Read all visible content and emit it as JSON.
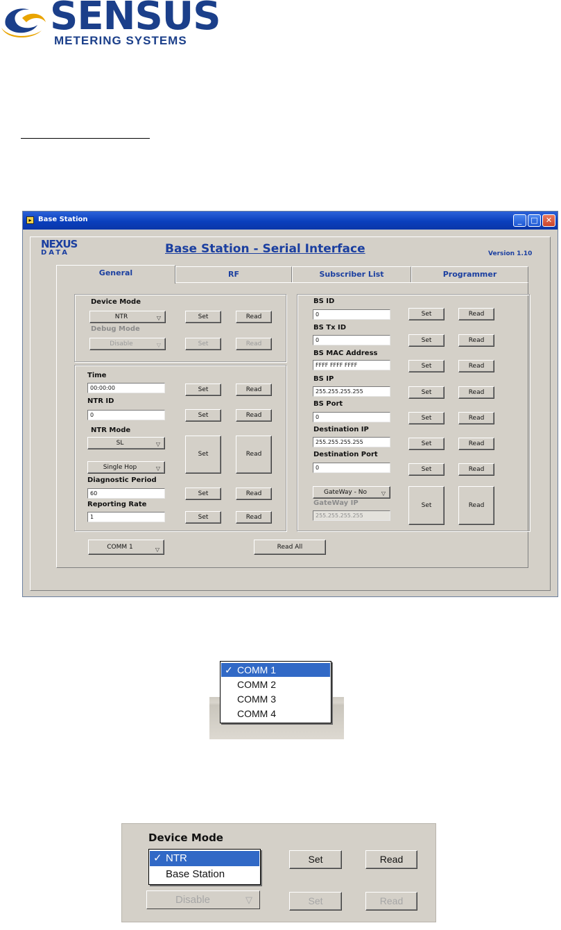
{
  "logo": {
    "word": "SENSUS",
    "subtitle": "METERING SYSTEMS"
  },
  "window": {
    "title": "Base Station",
    "controls": {
      "minimize": "_",
      "maximize": "□",
      "close": "✕"
    },
    "app_logo": {
      "top": "NEXUS",
      "bottom": "DATA"
    },
    "header_title": "Base Station - Serial Interface",
    "version": "Version 1.10",
    "tabs": [
      {
        "label": "General",
        "active": true
      },
      {
        "label": "RF",
        "active": false
      },
      {
        "label": "Subscriber List",
        "active": false
      },
      {
        "label": "Programmer",
        "active": false
      }
    ],
    "general": {
      "device_mode_label": "Device Mode",
      "device_mode_value": "NTR",
      "debug_mode_label": "Debug Mode",
      "debug_mode_value": "Disable",
      "time_label": "Time",
      "time_value": "00:00:00",
      "ntr_id_label": "NTR ID",
      "ntr_id_value": "0",
      "ntr_mode_label": "NTR Mode",
      "ntr_mode_value": "SL",
      "hop_value": "Single Hop",
      "diag_label": "Diagnostic Period",
      "diag_value": "60",
      "rate_label": "Reporting Rate",
      "rate_value": "1",
      "comm_value": "COMM 1",
      "read_all": "Read All",
      "bs_id_label": "BS ID",
      "bs_id_value": "0",
      "bs_tx_label": "BS Tx ID",
      "bs_tx_value": "0",
      "bs_mac_label": "BS MAC Address",
      "bs_mac_value": "FFFF FFFF FFFF",
      "bs_ip_label": "BS IP",
      "bs_ip_value": "255.255.255.255",
      "bs_port_label": "BS Port",
      "bs_port_value": "0",
      "dest_ip_label": "Destination IP",
      "dest_ip_value": "255.255.255.255",
      "dest_port_label": "Destination Port",
      "dest_port_value": "0",
      "gateway_value": "GateWay - No",
      "gateway_ip_label": "GateWay IP",
      "gateway_ip_value": "255.255.255.255",
      "set": "Set",
      "read": "Read"
    }
  },
  "comm_popup": {
    "check": "✓",
    "items": [
      "COMM 1",
      "COMM 2",
      "COMM 3",
      "COMM 4"
    ]
  },
  "device_mode_popup": {
    "label": "Device Mode",
    "check": "✓",
    "items": [
      "NTR",
      "Base Station"
    ],
    "debug_value": "Disable",
    "set": "Set",
    "read": "Read"
  }
}
